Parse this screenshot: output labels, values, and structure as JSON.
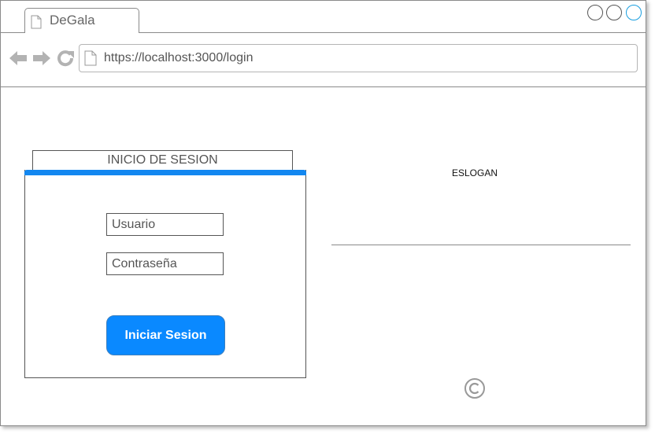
{
  "browser": {
    "tab_title": "DeGala",
    "url": "https://localhost:3000/login"
  },
  "login": {
    "title": "INICIO DE SESION",
    "username_placeholder": "Usuario",
    "password_placeholder": "Contraseña",
    "submit_label": "Iniciar Sesion",
    "accent_color": "#1287f0"
  },
  "aside": {
    "slogan": "ESLOGAN"
  },
  "icons": [
    "document-icon",
    "back-arrow-icon",
    "forward-arrow-icon",
    "reload-icon",
    "copyright-icon"
  ]
}
